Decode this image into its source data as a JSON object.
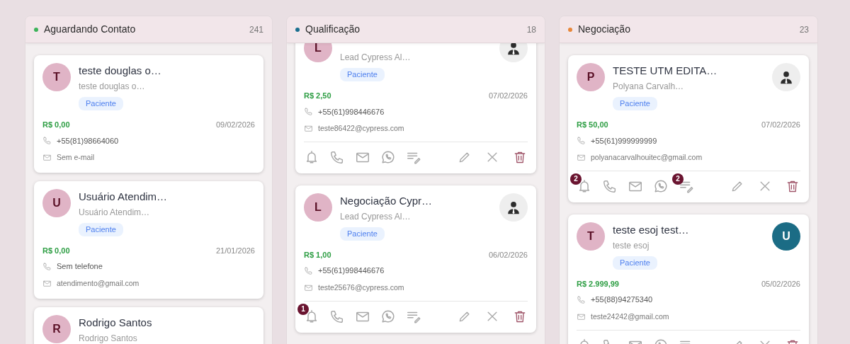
{
  "columns": [
    {
      "title": "Aguardando Contato",
      "count": "241",
      "color": "#3db35a",
      "scrolled": false,
      "cards": [
        {
          "kind": "contact",
          "initial": "T",
          "title": "teste douglas o…",
          "subtitle": "teste douglas o…",
          "tag": "Paciente",
          "value": "R$ 0,00",
          "date": "09/02/2026",
          "phone": "+55(81)98664060",
          "email": "Sem e-mail"
        },
        {
          "kind": "contact",
          "initial": "U",
          "title": "Usuário Atendim…",
          "subtitle": "Usuário Atendim…",
          "tag": "Paciente",
          "value": "R$ 0,00",
          "date": "21/01/2026",
          "phone": "Sem telefone",
          "email": "atendimento@gmail.com"
        },
        {
          "kind": "contact",
          "initial": "R",
          "title": "Rodrigo Santos",
          "subtitle": "Rodrigo Santos"
        }
      ]
    },
    {
      "title": "Qualificação",
      "count": "18",
      "color": "#1a6f8f",
      "scrolled": true,
      "cards": [
        {
          "kind": "deal",
          "initial": "L",
          "subtitle": "Lead Cypress Al…",
          "tag": "Paciente",
          "value": "R$ 2,50",
          "date": "07/02/2026",
          "phone": "+55(61)998446676",
          "email": "teste86422@cypress.com",
          "owner": {
            "kind": "silhouette"
          }
        },
        {
          "kind": "deal",
          "initial": "L",
          "title": "Negociação Cypr…",
          "subtitle": "Lead Cypress Al…",
          "tag": "Paciente",
          "value": "R$ 1,00",
          "date": "06/02/2026",
          "phone": "+55(61)998446676",
          "email": "teste25676@cypress.com",
          "owner": {
            "kind": "silhouette"
          },
          "reminder_badge": "1"
        }
      ]
    },
    {
      "title": "Negociação",
      "count": "23",
      "color": "#e8873a",
      "scrolled": false,
      "cards": [
        {
          "kind": "deal",
          "initial": "P",
          "title": "TESTE UTM EDITA…",
          "subtitle": "Polyana Carvalh…",
          "tag": "Paciente",
          "value": "R$ 50,00",
          "date": "07/02/2026",
          "phone": "+55(61)999999999",
          "email": "polyanacarvalhouitec@gmail.com",
          "owner": {
            "kind": "silhouette"
          },
          "reminder_badge": "2",
          "notes_badge": "2"
        },
        {
          "kind": "deal",
          "initial": "T",
          "title": "teste esoj test…",
          "subtitle": "teste esoj",
          "tag": "Paciente",
          "value": "R$ 2.999,99",
          "date": "05/02/2026",
          "phone": "+55(88)94275340",
          "email": "teste24242@gmail.com",
          "owner": {
            "kind": "initial",
            "initial": "U"
          }
        }
      ]
    }
  ]
}
